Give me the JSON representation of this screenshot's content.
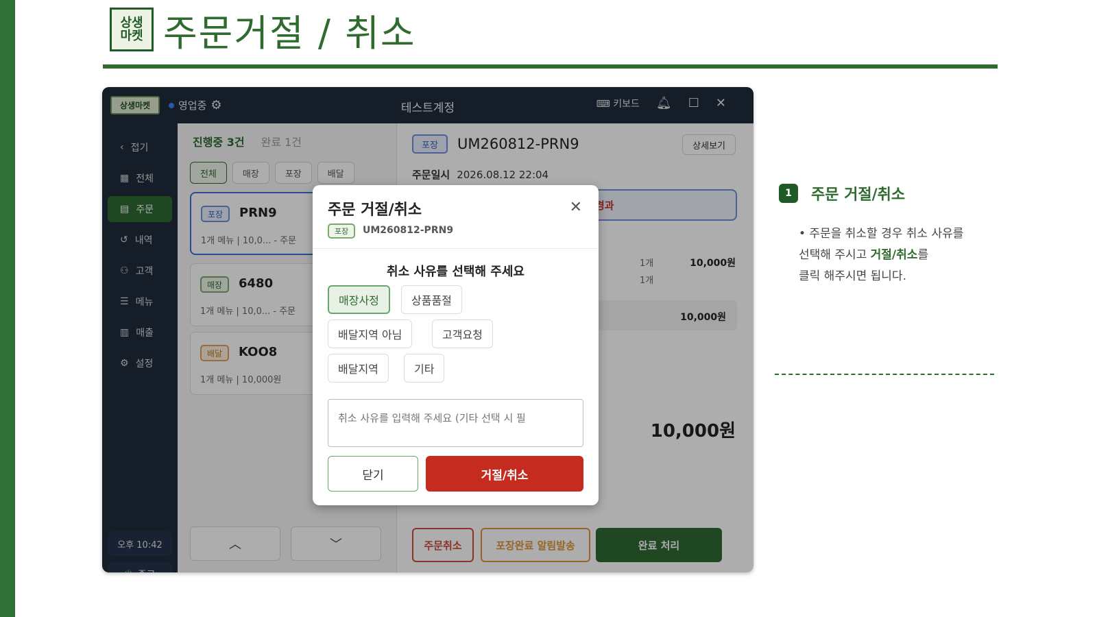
{
  "page": {
    "logo_text": "상생마켓",
    "title": "주문거절 / 취소"
  },
  "app": {
    "titlebar": {
      "logo": "상생마켓",
      "status": "영업중",
      "account": "테스트계정",
      "keyboard": "키보드"
    },
    "sidebar": {
      "items": [
        {
          "label": "접기",
          "icon": "chevron-left-icon",
          "glyph": "‹"
        },
        {
          "label": "전체",
          "icon": "grid-icon",
          "glyph": "▦"
        },
        {
          "label": "주문",
          "icon": "clipboard-icon",
          "glyph": "▤"
        },
        {
          "label": "내역",
          "icon": "history-icon",
          "glyph": "↺"
        },
        {
          "label": "고객",
          "icon": "user-icon",
          "glyph": "⚇"
        },
        {
          "label": "메뉴",
          "icon": "list-icon",
          "glyph": "☰"
        },
        {
          "label": "매출",
          "icon": "bar-chart-icon",
          "glyph": "▥"
        },
        {
          "label": "설정",
          "icon": "gear-icon",
          "glyph": "⚙"
        }
      ],
      "time": "오후 10:42",
      "exit": "종료"
    },
    "list": {
      "active_count": "진행중 3건",
      "done_count": "완료 1건",
      "filters": [
        "전체",
        "매장",
        "포장",
        "배달"
      ],
      "orders": [
        {
          "type": "포장",
          "id": "PRN9",
          "summary": "1개 메뉴  |  10,0...  -  주문"
        },
        {
          "type": "매장",
          "id": "6480",
          "summary": "1개 메뉴  |  10,0...  -  주문"
        },
        {
          "type": "배달",
          "id": "KOO8",
          "summary": "1개 메뉴  |  10,000원"
        }
      ]
    },
    "detail": {
      "type": "포장",
      "order_no": "UM260812-PRN9",
      "detail_button": "상세보기",
      "date_label": "주문일시",
      "date_value": "2026.08.12 22:04",
      "status_text": "경과",
      "qty1": "1개",
      "qty2": "1개",
      "line_amount": "10,000원",
      "subtotal": "10,000원",
      "total": "10,000원",
      "btn_cancel": "주문취소",
      "btn_notify": "포장완료 알림발송",
      "btn_done": "완료 처리"
    },
    "modal": {
      "title": "주문 거절/취소",
      "type": "포장",
      "order_no": "UM260812-PRN9",
      "question": "취소 사유를 선택해 주세요",
      "reasons": [
        "매장사정",
        "상품품절",
        "배달지역 아님",
        "고객요청",
        "배달지역",
        "기타"
      ],
      "selected_reason": "매장사정",
      "placeholder": "취소 사유를 입력해 주세요 (기타 선택 시 필",
      "btn_close": "닫기",
      "btn_reject": "거절/취소"
    }
  },
  "note": {
    "number": "1",
    "title": "주문 거절/취소",
    "line1": "• 주문을 취소할 경우 취소 사유를",
    "line2_pre": "선택해 주시고 ",
    "line2_hl": "거절/취소",
    "line2_post": "를",
    "line3": "클릭 해주시면 됩니다."
  },
  "colors": {
    "brand_green": "#2f6b2f",
    "reject_red": "#c52b1f",
    "titlebar": "#1f2b3b"
  }
}
